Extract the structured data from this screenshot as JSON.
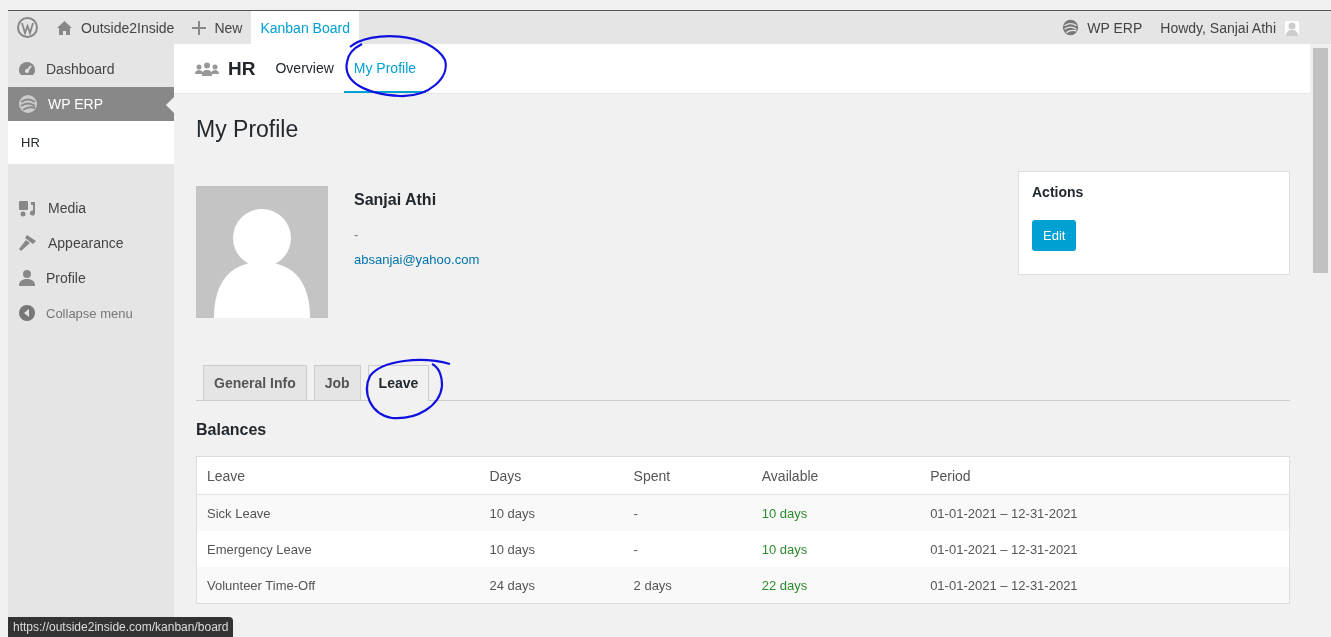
{
  "admin_bar": {
    "site_name": "Outside2Inside",
    "new_label": "New",
    "kanban": {
      "label": "Kanban Board",
      "selected": true
    },
    "erp_label": "WP ERP",
    "greeting": "Howdy, Sanjai Athi"
  },
  "sidebar": {
    "items": [
      {
        "label": "Dashboard",
        "kind": "dashboard",
        "selected": false
      },
      {
        "label": "WP ERP",
        "kind": "erp",
        "selected": true,
        "children": [
          {
            "label": "HR"
          }
        ]
      },
      {
        "label": "Media",
        "kind": "media",
        "selected": false
      },
      {
        "label": "Appearance",
        "kind": "appearance",
        "selected": false
      },
      {
        "label": "Profile",
        "kind": "profile",
        "selected": false
      },
      {
        "label": "Collapse menu",
        "kind": "collapse",
        "selected": false
      }
    ]
  },
  "header": {
    "title": "HR",
    "tabs": [
      {
        "label": "Overview",
        "selected": false
      },
      {
        "label": "My Profile",
        "selected": true
      }
    ]
  },
  "page_title": "My Profile",
  "profile": {
    "name": "Sanjai Athi",
    "job_title": "-",
    "email": "absanjai@yahoo.com"
  },
  "actions": {
    "title": "Actions",
    "button": "Edit"
  },
  "tabs": [
    {
      "label": "General Info",
      "selected": false
    },
    {
      "label": "Job",
      "selected": false
    },
    {
      "label": "Leave",
      "selected": true
    }
  ],
  "balances": {
    "title": "Balances",
    "columns": [
      {
        "label": "Leave",
        "highlight": false
      },
      {
        "label": "Days",
        "highlight": false
      },
      {
        "label": "Spent",
        "highlight": false
      },
      {
        "label": "Available",
        "highlight": true
      },
      {
        "label": "Period",
        "highlight": false
      }
    ],
    "rows": [
      [
        "Sick Leave",
        "10 days",
        "-",
        "10 days",
        "01-01-2021 – 12-31-2021"
      ],
      [
        "Emergency Leave",
        "10 days",
        "-",
        "10 days",
        "01-01-2021 – 12-31-2021"
      ],
      [
        "Volunteer Time-Off",
        "24 days",
        "2 days",
        "22 days",
        "01-01-2021 – 12-31-2021"
      ]
    ]
  },
  "status_url": "https://outside2inside.com/kanban/board"
}
